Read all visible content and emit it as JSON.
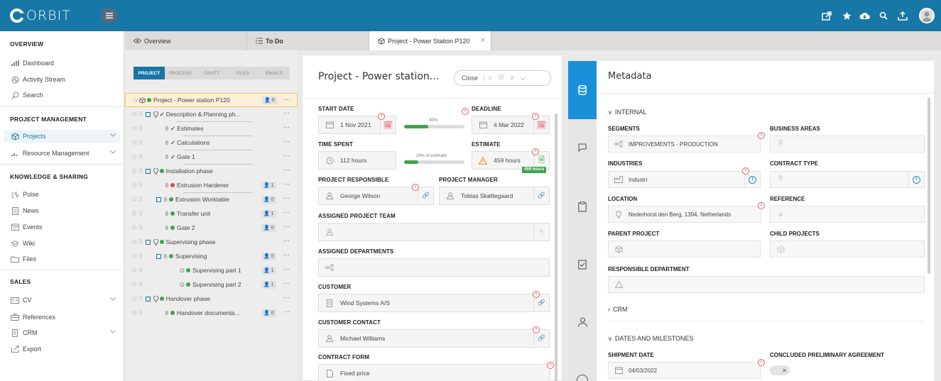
{
  "app": {
    "logo_text": "ORBIT",
    "brand_color": "#1777a6"
  },
  "topbar": {
    "icons": [
      "share-icon",
      "star-icon",
      "cloud-icon",
      "search-icon",
      "upload-icon",
      "avatar"
    ]
  },
  "sidebar": {
    "sections": [
      {
        "title": "OVERVIEW",
        "items": [
          {
            "label": "Dashboard",
            "icon": "chart-icon"
          },
          {
            "label": "Activity Stream",
            "icon": "activity-icon"
          },
          {
            "label": "Search",
            "icon": "search-icon"
          }
        ]
      },
      {
        "title": "PROJECT MANAGEMENT",
        "items": [
          {
            "label": "Projects",
            "icon": "cube-icon",
            "active": true
          },
          {
            "label": "Resource Management",
            "icon": "bars-icon"
          }
        ]
      },
      {
        "title": "KNOWLEDGE & SHARING",
        "items": [
          {
            "label": "Pulse",
            "icon": "pulse-icon"
          },
          {
            "label": "News",
            "icon": "news-icon"
          },
          {
            "label": "Events",
            "icon": "calendar-icon"
          },
          {
            "label": "Wiki",
            "icon": "wiki-icon"
          },
          {
            "label": "Files",
            "icon": "folder-icon"
          }
        ]
      },
      {
        "title": "SALES",
        "items": [
          {
            "label": "CV",
            "icon": "cv-icon"
          },
          {
            "label": "References",
            "icon": "briefcase-icon"
          },
          {
            "label": "CRM",
            "icon": "crm-icon"
          },
          {
            "label": "Export",
            "icon": "export-icon"
          }
        ]
      }
    ]
  },
  "tabs": [
    {
      "label": "Overview"
    },
    {
      "label": "To Do"
    },
    {
      "label": "Project - Power Station P120",
      "active": true
    }
  ],
  "subtabs": [
    "PROJECT",
    "PROCESS",
    "GANTT",
    "FILES",
    "EMAILS"
  ],
  "tree": [
    {
      "label": "Project - Power station P120",
      "count": "0",
      "dot": "#3fa34d"
    },
    {
      "label": "Description & Planning ph...",
      "check": true
    },
    {
      "label": "Estimates",
      "check": true
    },
    {
      "label": "Calculations",
      "check": true
    },
    {
      "label": "Gate 1",
      "check": true
    },
    {
      "label": "Installation phase",
      "dot": "#3fa34d"
    },
    {
      "label": "Extrusion Hardener",
      "count": "1",
      "dot": "#e04848"
    },
    {
      "label": "Extrusion Worktable",
      "count": "0",
      "dot": "#3fa34d"
    },
    {
      "label": "Transfer unit",
      "count": "1",
      "dot": "#3fa34d"
    },
    {
      "label": "Gate 2",
      "count": "0",
      "dot": "#3fa34d"
    },
    {
      "label": "Supervising phase",
      "dot": "#3fa34d"
    },
    {
      "label": "Supervising",
      "count": "0",
      "dot": "#3fa34d"
    },
    {
      "label": "Supervising part 1",
      "count": "1",
      "dot": "#3fa34d"
    },
    {
      "label": "Supervising part 2",
      "count": "1",
      "dot": "#3fa34d"
    },
    {
      "label": "Handover phase",
      "dot": "#3fa34d"
    },
    {
      "label": "Handover documenta...",
      "count": "0",
      "dot": "#3fa34d"
    }
  ],
  "project": {
    "title": "Project - Power station...",
    "close_label": "Close",
    "start_date_label": "START DATE",
    "start_date": "1 Nov 2021",
    "progress_label": "40%",
    "progress": 0.4,
    "deadline_label": "DEADLINE",
    "deadline": "4 Mar 2022",
    "time_spent_label": "TIME SPENT",
    "time_spent": "112 hours",
    "estimate_pct_label": "24% of estimate",
    "estimate_pct": 0.24,
    "estimate_label": "ESTIMATE",
    "estimate": "459 hours",
    "estimate_badge": "459 hours",
    "responsible_label": "PROJECT RESPONSIBLE",
    "responsible": "George Wilson",
    "manager_label": "PROJECT MANAGER",
    "manager": "Tobias Skøttegaard",
    "team_label": "ASSIGNED PROJECT TEAM",
    "departments_label": "ASSIGNED DEPARTMENTS",
    "customer_label": "CUSTOMER",
    "customer": "Wind Systems A/S",
    "contact_label": "CUSTOMER CONTACT",
    "contact": "Michael Williams",
    "contract_form_label": "CONTRACT FORM",
    "contract_form": "Fixed price"
  },
  "metadata": {
    "title": "Metadata",
    "internal_label": "INTERNAL",
    "segments_label": "SEGMENTS",
    "segments": "IMPROVEMENTS - PRODUCTION",
    "business_areas_label": "BUSINESS AREAS",
    "industries_label": "INDUSTRIES",
    "industries": "Industri",
    "contract_type_label": "CONTRACT TYPE",
    "location_label": "LOCATION",
    "location": "Nederhorst den Berg, 1394, Netherlands",
    "reference_label": "REFERENCE",
    "parent_label": "PARENT PROJECT",
    "child_label": "CHILD PROJECTS",
    "resp_dept_label": "RESPONSIBLE DEPARTMENT",
    "crm_label": "CRM",
    "dates_label": "DATES AND MILESTONES",
    "shipment_label": "SHIPMENT DATE",
    "shipment": "04/03/2022",
    "concluded_label": "CONCLUDED PRELIMINARY AGREEMENT"
  }
}
